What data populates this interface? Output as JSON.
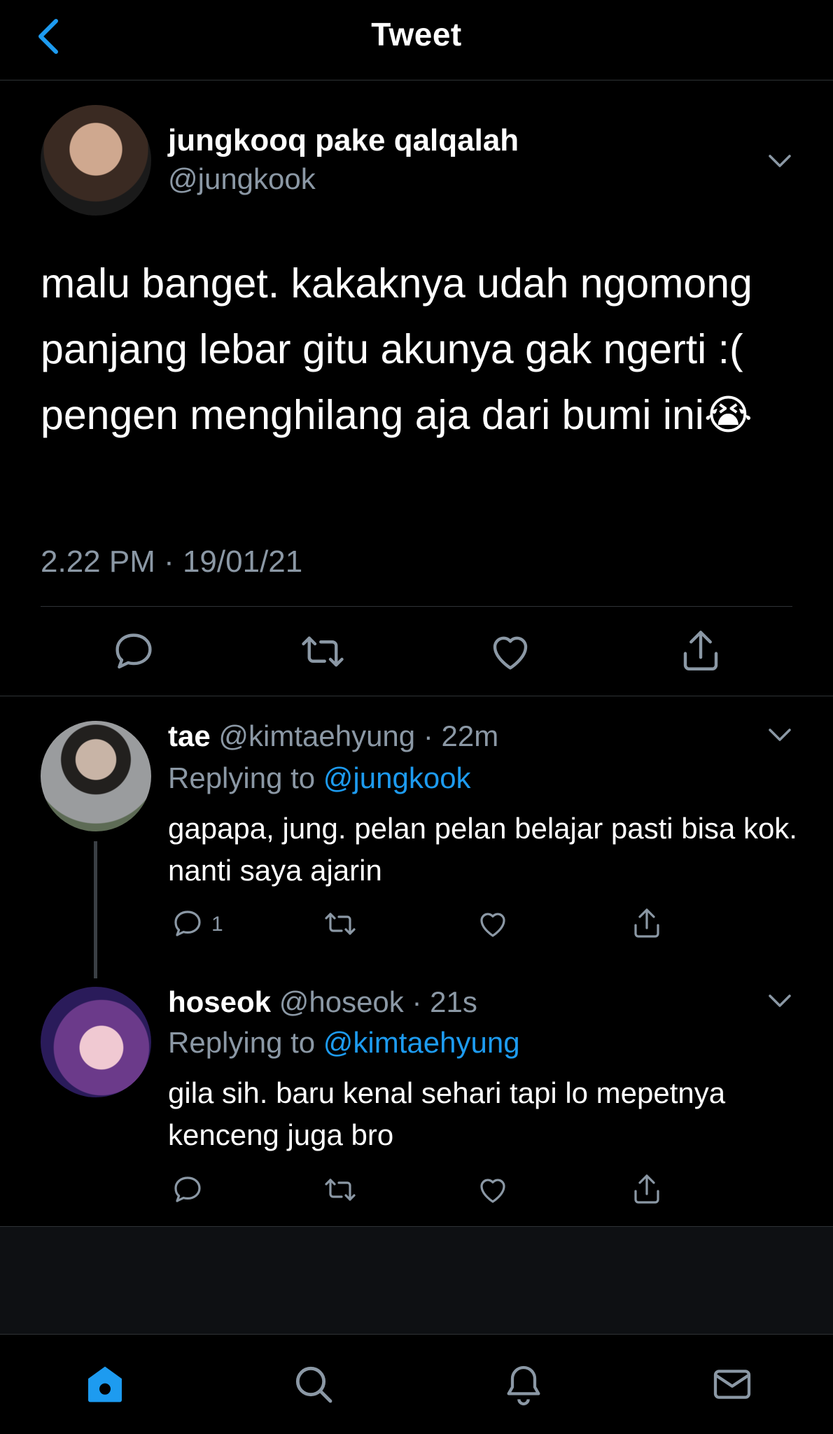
{
  "header": {
    "title": "Tweet",
    "back_icon": "chevron-left-icon"
  },
  "colors": {
    "accent": "#1d9bf0",
    "muted": "#8b98a5",
    "background": "#000000"
  },
  "main_tweet": {
    "display_name": "jungkooq pake qalqalah",
    "handle": "@jungkook",
    "text": "malu banget. kakaknya udah ngomong panjang lebar gitu akunya gak ngerti :( pengen menghilang aja dari bumi ini😭",
    "timestamp": "2.22 PM · 19/01/21",
    "actions": [
      "reply-icon",
      "retweet-icon",
      "like-icon",
      "share-icon"
    ]
  },
  "replies": [
    {
      "display_name": "tae",
      "handle": "@kimtaehyung",
      "time": "· 22m",
      "replying_prefix": "Replying to ",
      "replying_to": "@jungkook",
      "text": "gapapa, jung. pelan pelan belajar pasti bisa kok. nanti saya ajarin",
      "reply_count": "1"
    },
    {
      "display_name": "hoseok",
      "handle": "@hoseok",
      "time": "· 21s",
      "replying_prefix": "Replying to ",
      "replying_to": "@kimtaehyung",
      "text": "gila sih. baru kenal sehari tapi lo mepetnya kenceng juga bro",
      "reply_count": ""
    }
  ],
  "bottom_nav": [
    "home-icon",
    "search-icon",
    "notifications-icon",
    "messages-icon"
  ]
}
